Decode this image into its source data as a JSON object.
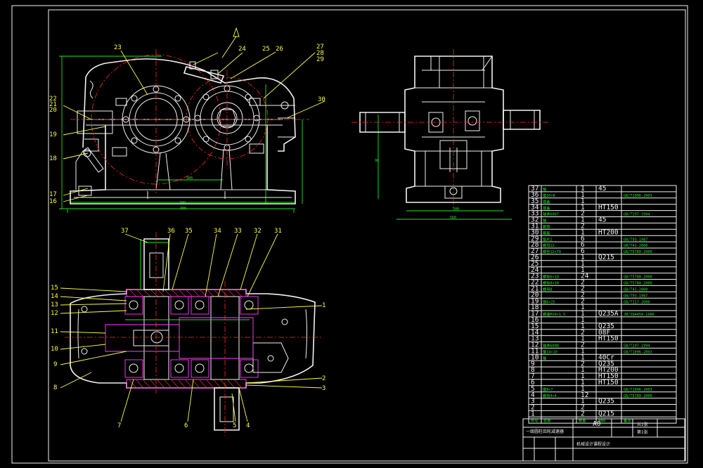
{
  "colors": {
    "background": "#000000",
    "outline": "#f2f2f2",
    "leader": "#ffff44",
    "dimension": "#22e622",
    "centerline": "#ff2a2a",
    "section": "#ff40ff",
    "hidden": "#33dddd"
  },
  "front_view": {
    "callouts": [
      {
        "id": "fv-23",
        "text": "23"
      },
      {
        "id": "fv-24",
        "text": "24"
      },
      {
        "id": "fv-25",
        "text": "25"
      },
      {
        "id": "fv-26",
        "text": "26"
      },
      {
        "id": "fv-27",
        "text": "27"
      },
      {
        "id": "fv-28",
        "text": "28"
      },
      {
        "id": "fv-29",
        "text": "29"
      },
      {
        "id": "fv-30",
        "text": "30"
      },
      {
        "id": "fv-22",
        "text": "22"
      },
      {
        "id": "fv-21",
        "text": "21"
      },
      {
        "id": "fv-20",
        "text": "20"
      },
      {
        "id": "fv-19",
        "text": "19"
      },
      {
        "id": "fv-18",
        "text": "18"
      },
      {
        "id": "fv-17",
        "text": "17"
      },
      {
        "id": "fv-16",
        "text": "16"
      }
    ]
  },
  "top_view": {
    "callouts": [
      {
        "id": "tv-37",
        "text": "37"
      },
      {
        "id": "tv-36",
        "text": "36"
      },
      {
        "id": "tv-35",
        "text": "35"
      },
      {
        "id": "tv-34",
        "text": "34"
      },
      {
        "id": "tv-33",
        "text": "33"
      },
      {
        "id": "tv-32",
        "text": "32"
      },
      {
        "id": "tv-31",
        "text": "31"
      },
      {
        "id": "tv-15",
        "text": "15"
      },
      {
        "id": "tv-14",
        "text": "14"
      },
      {
        "id": "tv-13",
        "text": "13"
      },
      {
        "id": "tv-12",
        "text": "12"
      },
      {
        "id": "tv-11",
        "text": "11"
      },
      {
        "id": "tv-10",
        "text": "10"
      },
      {
        "id": "tv-9",
        "text": "9"
      },
      {
        "id": "tv-8",
        "text": "8"
      },
      {
        "id": "tv-7",
        "text": "7"
      },
      {
        "id": "tv-6",
        "text": "6"
      },
      {
        "id": "tv-5",
        "text": "5"
      },
      {
        "id": "tv-4",
        "text": "4"
      },
      {
        "id": "tv-3",
        "text": "3"
      },
      {
        "id": "tv-2",
        "text": "2"
      },
      {
        "id": "tv-1",
        "text": "1"
      }
    ]
  },
  "parts_list": {
    "rows": [
      {
        "no": "37",
        "name": "轴",
        "qty": "1",
        "mat": "45",
        "std": ""
      },
      {
        "no": "36",
        "name": "键10×8",
        "qty": "1",
        "mat": "",
        "std": "GB/T1096-2003"
      },
      {
        "no": "35",
        "name": "端盖",
        "qty": "1",
        "mat": "",
        "std": ""
      },
      {
        "no": "34",
        "name": "端盖",
        "qty": "1",
        "mat": "HT150",
        "std": ""
      },
      {
        "no": "33",
        "name": "轴承6007",
        "qty": "2",
        "mat": "",
        "std": "GB/T297-1994"
      },
      {
        "no": "32",
        "name": "轴",
        "qty": "1",
        "mat": "45",
        "std": ""
      },
      {
        "no": "31",
        "name": "套筒",
        "qty": "2",
        "mat": "",
        "std": ""
      },
      {
        "no": "30",
        "name": "箱盖",
        "qty": "1",
        "mat": "HT200",
        "std": ""
      },
      {
        "no": "29",
        "name": "垫片2",
        "qty": "6",
        "mat": "",
        "std": "GB/T93-1987"
      },
      {
        "no": "28",
        "name": "螺母12",
        "qty": "6",
        "mat": "",
        "std": "GB/T41-2000"
      },
      {
        "no": "27",
        "name": "螺栓12×70",
        "qty": "6",
        "mat": "",
        "std": "GB/T5780-2000"
      },
      {
        "no": "26",
        "name": "",
        "qty": "1",
        "mat": "Q215",
        "std": ""
      },
      {
        "no": "25",
        "name": "",
        "qty": "1",
        "mat": "",
        "std": ""
      },
      {
        "no": "24",
        "name": "",
        "qty": "1",
        "mat": "",
        "std": ""
      },
      {
        "no": "23",
        "name": "螺栓6×10",
        "qty": "24",
        "mat": "",
        "std": "GB/T5780-2000"
      },
      {
        "no": "22",
        "name": "螺栓8×30",
        "qty": "2",
        "mat": "",
        "std": "GB/T5780-2000"
      },
      {
        "no": "21",
        "name": "螺母8",
        "qty": "2",
        "mat": "",
        "std": "GB/T41-2000"
      },
      {
        "no": "20",
        "name": "",
        "qty": "2",
        "mat": "",
        "std": "GB/T93-1987"
      },
      {
        "no": "19",
        "name": "销6×25",
        "qty": "2",
        "mat": "",
        "std": "GB/T117-2000"
      },
      {
        "no": "18",
        "name": "",
        "qty": "1",
        "mat": "",
        "std": ""
      },
      {
        "no": "17",
        "name": "螺塞M10×1.5",
        "qty": "1",
        "mat": "Q235A",
        "std": "JB/ZQ4450-1986"
      },
      {
        "no": "16",
        "name": "",
        "qty": "1",
        "mat": "",
        "std": ""
      },
      {
        "no": "15",
        "name": "",
        "qty": "1",
        "mat": "Q235",
        "std": ""
      },
      {
        "no": "14",
        "name": "",
        "qty": "2",
        "mat": "08F",
        "std": ""
      },
      {
        "no": "13",
        "name": "",
        "qty": "1",
        "mat": "HT150",
        "std": ""
      },
      {
        "no": "12",
        "name": "轴承6008",
        "qty": "2",
        "mat": "",
        "std": "GB/T297-1994"
      },
      {
        "no": "11",
        "name": "键14×10",
        "qty": "1",
        "mat": "",
        "std": "GB/T1096-2003"
      },
      {
        "no": "10",
        "name": "轴",
        "qty": "1",
        "mat": "40Cr",
        "std": ""
      },
      {
        "no": "9",
        "name": "",
        "qty": "2",
        "mat": "Q235",
        "std": ""
      },
      {
        "no": "8",
        "name": "",
        "qty": "1",
        "mat": "HT200",
        "std": ""
      },
      {
        "no": "7",
        "name": "",
        "qty": "1",
        "mat": "HT150",
        "std": ""
      },
      {
        "no": "6",
        "name": "",
        "qty": "1",
        "mat": "HT150",
        "std": ""
      },
      {
        "no": "5",
        "name": "键8×7",
        "qty": "1",
        "mat": "",
        "std": "GB/T1096-2003"
      },
      {
        "no": "4",
        "name": "螺栓4×4",
        "qty": "12",
        "mat": "",
        "std": "GB/T5780-2000"
      },
      {
        "no": "3",
        "name": "",
        "qty": "1",
        "mat": "Q235",
        "std": ""
      },
      {
        "no": "2",
        "name": "",
        "qty": "2",
        "mat": "",
        "std": ""
      },
      {
        "no": "1",
        "name": "",
        "qty": "2",
        "mat": "Q215",
        "std": ""
      }
    ],
    "header": {
      "no": "序号",
      "name": "名称",
      "qty": "数量",
      "mat": "材料",
      "std": "备注"
    }
  },
  "title_block": {
    "product": "一级圆柱齿轮减速器",
    "sheet_size": "A0",
    "sheet_count": "共1张",
    "sheet_no": "第1张",
    "school": "机械设计课程设计"
  }
}
